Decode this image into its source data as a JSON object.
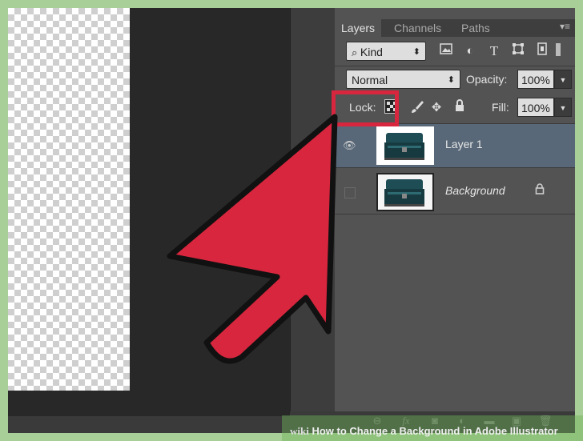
{
  "tabs": [
    {
      "label": "Layers"
    },
    {
      "label": "Channels"
    },
    {
      "label": "Paths"
    }
  ],
  "panel_menu_icon": "panel-menu-icon",
  "filter": {
    "kind_label": "Kind",
    "arrows": "⬍"
  },
  "blend": {
    "mode": "Normal",
    "opacity_label": "Opacity:",
    "opacity_value": "100%"
  },
  "lock": {
    "label": "Lock:",
    "fill_label": "Fill:",
    "fill_value": "100%"
  },
  "layers": [
    {
      "name": "Layer 1",
      "visible": true,
      "selected": true,
      "locked": false
    },
    {
      "name": "Background",
      "visible": false,
      "selected": false,
      "locked": true
    }
  ],
  "watermark": {
    "brand": "wiki",
    "text": "How to Change a Background in Adobe Illustrator"
  },
  "colors": {
    "accent": "#d7263d",
    "panel": "#535353",
    "selected_row": "#586878",
    "frame_bg": "#a9cf98"
  }
}
